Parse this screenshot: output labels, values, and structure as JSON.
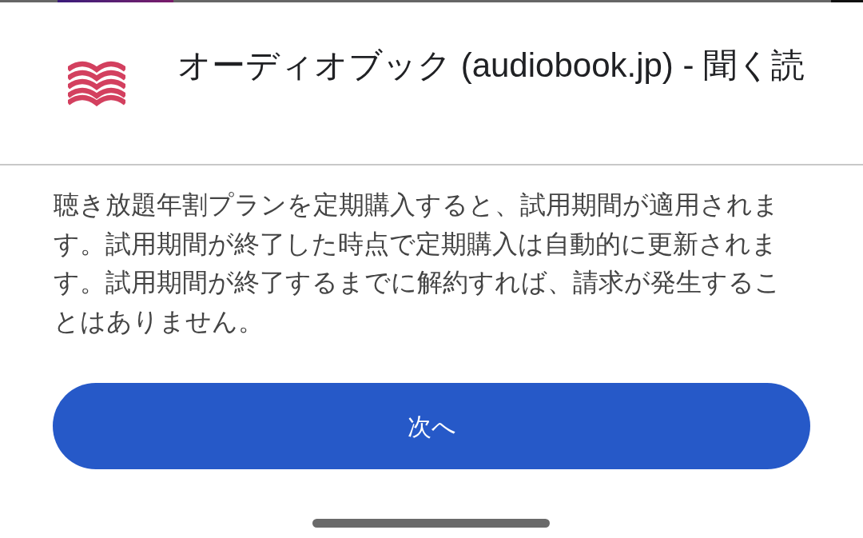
{
  "app": {
    "title": "オーディオブック (audiobook.jp) - 聞く読"
  },
  "message": "聴き放題年割プランを定期購入すると、試用期間が適用されます。試用期間が終了した時点で定期購入は自動的に更新されます。試用期間が終了するまでに解約すれば、請求が発生することはありません。",
  "buttons": [
    {
      "label": "次へ",
      "kind": "primary"
    }
  ]
}
